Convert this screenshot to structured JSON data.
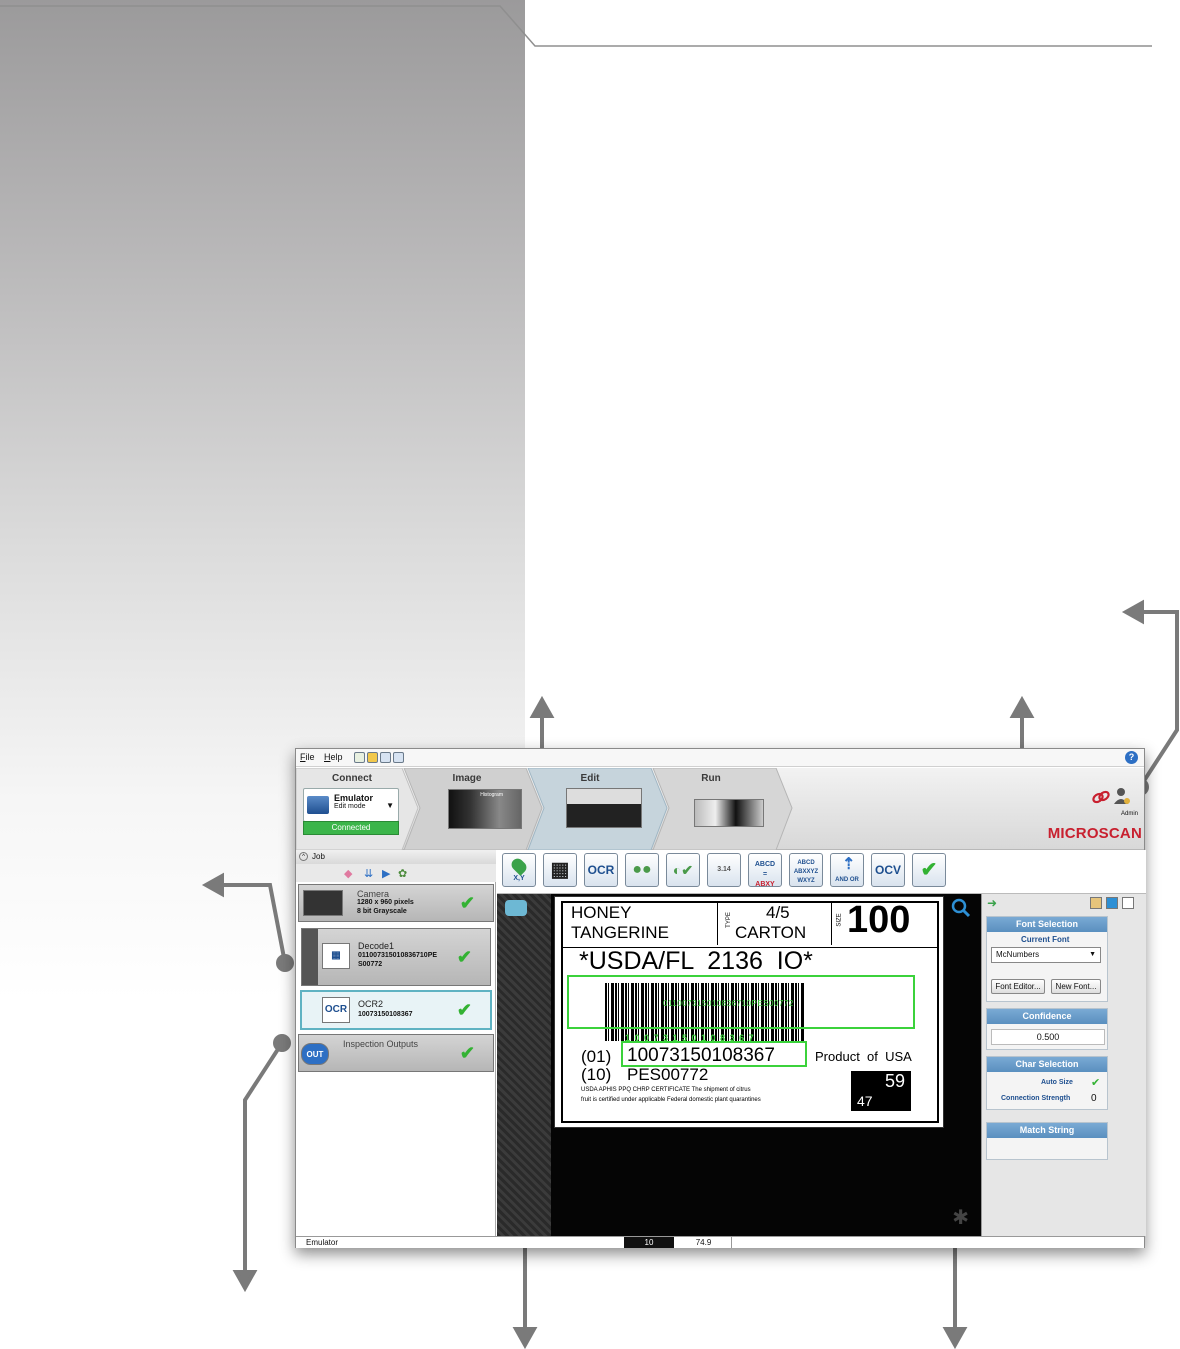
{
  "menu": {
    "file": "File",
    "help": "Help"
  },
  "workflow": {
    "steps": [
      "Connect",
      "Image",
      "Edit",
      "Run"
    ],
    "device": {
      "name": "Emulator",
      "mode": "Edit mode",
      "status": "Connected"
    },
    "histogram_label": "Histogram",
    "user": "Admin",
    "brand": "MICROSCAN"
  },
  "job": {
    "title": "Job",
    "items": [
      {
        "name": "Camera",
        "detail1": "1280 x 960 pixels",
        "detail2": "8 bit Grayscale"
      },
      {
        "name": "Decode1",
        "detail1": "011007315010836710PE",
        "detail2": "S00772"
      },
      {
        "name": "OCR2",
        "detail1": "10073150108367",
        "detail2": ""
      },
      {
        "name": "Inspection Outputs",
        "detail1": "",
        "detail2": ""
      }
    ]
  },
  "palette": {
    "buttons": [
      "X,Y",
      "BARCODE",
      "OCR",
      "COUNT",
      "PRESENCE",
      "3.14",
      "ABCD=ABXY",
      "ABCD ABXXYZ WXYZ",
      "AND OR",
      "OCV",
      "VERIFY"
    ],
    "labels": {
      "xy": "X,Y",
      "ocr": "OCR",
      "ocv": "OCV",
      "andor": "AND OR",
      "measure": "3.14",
      "strmatch_top": "ABCD",
      "strmatch_mid": "ABXY"
    }
  },
  "label": {
    "line1a": "HONEY",
    "line1b": "TANGERINE",
    "type": "TYPE",
    "qty": "4/5",
    "unit": "CARTON",
    "size": "SIZE",
    "size_value": "100",
    "usda": "*USDA/FL  2136  IO*",
    "ai1": "(01)",
    "gtin": "10073150108367",
    "ai2": "(10)",
    "lot": "PES00772",
    "product": "Product  of  USA",
    "cert1": "USDA APHIS PPQ CHRP CERTIFICATE The shipment of citrus",
    "cert2": "fruit is certified under applicable Federal domestic plant quarantines",
    "box_top": "59",
    "box_bottom": "47",
    "green_code": "011007315010836710PES00772",
    "green_digits": "1 0 0 7 3 1 5 0 1 0 8 3 6 7"
  },
  "props": {
    "font_selection": "Font Selection",
    "current_font": "Current Font",
    "font_value": "McNumbers",
    "font_editor": "Font Editor...",
    "new_font": "New Font...",
    "confidence": "Confidence",
    "confidence_value": "0.500",
    "char_selection": "Char Selection",
    "auto_size": "Auto Size",
    "connection_strength": "Connection Strength",
    "connection_value": "0",
    "match_string": "Match String"
  },
  "status": {
    "left": "Emulator",
    "mid": "10",
    "right": "74.9"
  },
  "colors": {
    "accent": "#5a8fbf",
    "ok": "#33b233",
    "brand": "#c8202f",
    "arrow": "#7a7a7a"
  }
}
